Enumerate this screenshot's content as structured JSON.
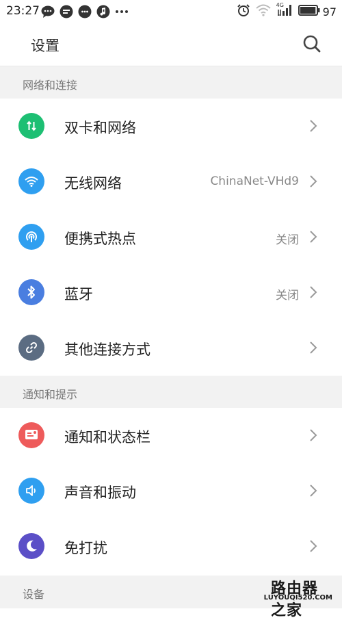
{
  "status_bar": {
    "time": "23:27",
    "network_type": "4G",
    "battery": "97",
    "battery_level": 0.97
  },
  "header": {
    "title": "设置"
  },
  "sections": [
    {
      "title": "网络和连接",
      "items": [
        {
          "label": "双卡和网络",
          "value": "",
          "icon": "dual-sim-icon",
          "color": "#1dbf73"
        },
        {
          "label": "无线网络",
          "value": "ChinaNet-VHd9",
          "icon": "wifi-icon",
          "color": "#2f9ff0"
        },
        {
          "label": "便携式热点",
          "value": "关闭",
          "icon": "hotspot-icon",
          "color": "#2f9ff0"
        },
        {
          "label": "蓝牙",
          "value": "关闭",
          "icon": "bluetooth-icon",
          "color": "#4a7ee0"
        },
        {
          "label": "其他连接方式",
          "value": "",
          "icon": "link-icon",
          "color": "#5b6c82"
        }
      ]
    },
    {
      "title": "通知和提示",
      "items": [
        {
          "label": "通知和状态栏",
          "value": "",
          "icon": "notification-icon",
          "color": "#ee5b5b"
        },
        {
          "label": "声音和振动",
          "value": "",
          "icon": "sound-icon",
          "color": "#2f9ff0"
        },
        {
          "label": "免打扰",
          "value": "",
          "icon": "moon-icon",
          "color": "#5b4fc7"
        }
      ]
    },
    {
      "title": "设备",
      "items": []
    }
  ],
  "watermark": {
    "line1": "路由器之家",
    "line2": "LUYOUQI520.COM"
  }
}
